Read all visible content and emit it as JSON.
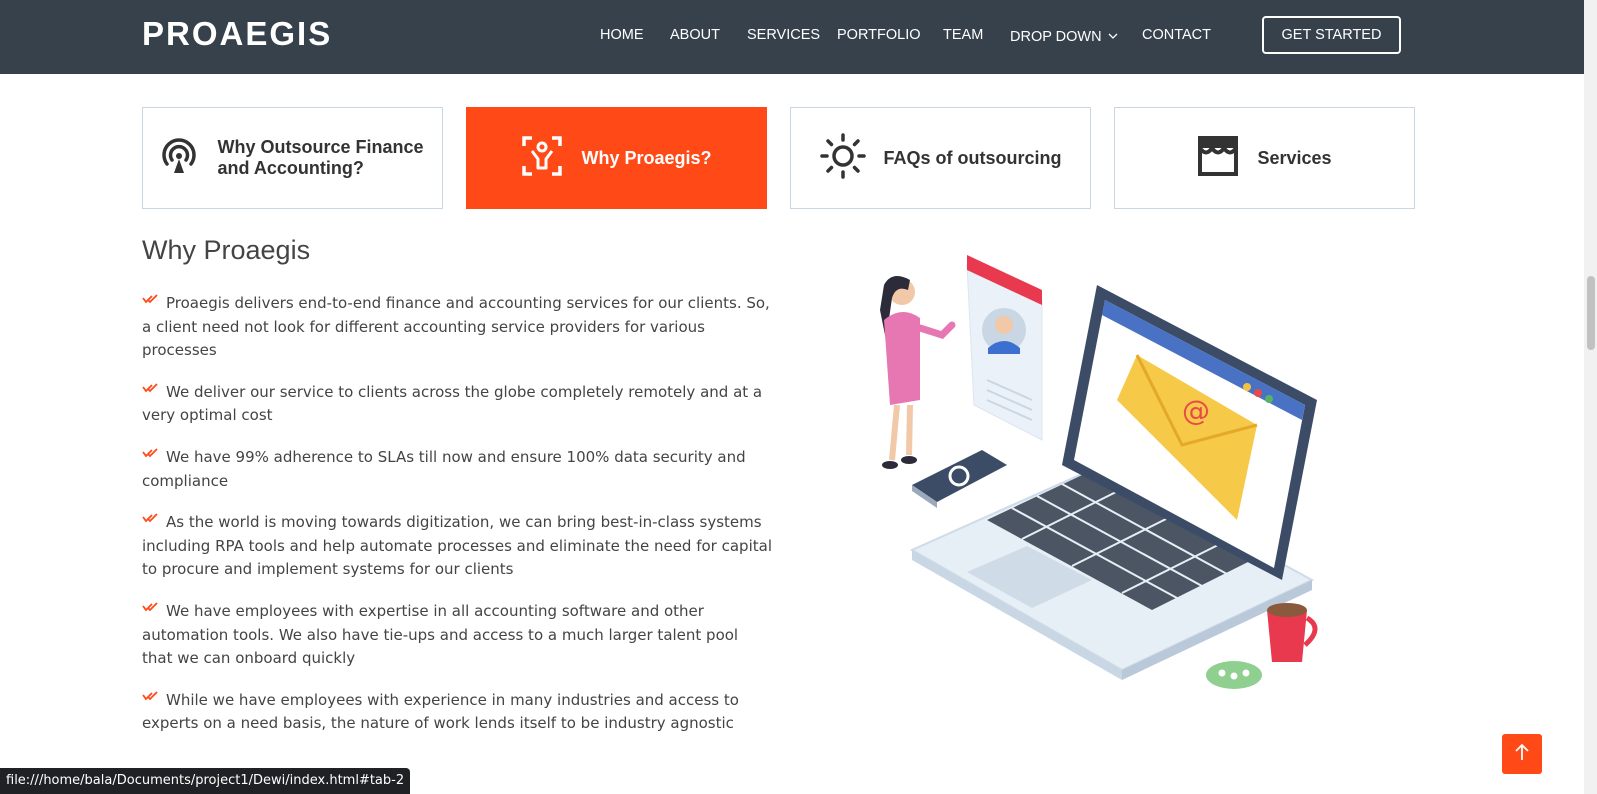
{
  "header": {
    "logo": "PROAEGIS",
    "nav": [
      {
        "label": "HOME"
      },
      {
        "label": "ABOUT"
      },
      {
        "label": "SERVICES"
      },
      {
        "label": "PORTFOLIO"
      },
      {
        "label": "TEAM"
      },
      {
        "label": "DROP DOWN"
      },
      {
        "label": "CONTACT"
      }
    ],
    "cta_label": "GET STARTED"
  },
  "tabs": [
    {
      "label": "Why Outsource Finance and Accounting?",
      "icon": "broadcast-icon",
      "active": false
    },
    {
      "label": "Why Proaegis?",
      "icon": "person-focus-icon",
      "active": true
    },
    {
      "label": "FAQs of outsourcing",
      "icon": "sun-icon",
      "active": false
    },
    {
      "label": "Services",
      "icon": "store-icon",
      "active": false
    }
  ],
  "content": {
    "title": "Why Proaegis",
    "items": [
      "Proaegis delivers end-to-end finance and accounting services for our clients. So, a client need not look for different accounting service providers for various processes",
      "We deliver our service to clients across the globe completely remotely and at a very optimal cost",
      "We have 99% adherence to SLAs till now and ensure 100% data security and compliance",
      "As the world is moving towards digitization, we can bring best-in-class systems including RPA tools and help automate processes and eliminate the need for capital to procure and implement systems for our clients",
      "We have employees with expertise in all accounting software and other automation tools. We also have tie-ups and access to a much larger talent pool that we can onboard quickly",
      "While we have employees with experience in many industries and access to experts on a need basis, the nature of work lends itself to be industry agnostic"
    ]
  },
  "status_url": "file:///home/bala/Documents/project1/Dewi/index.html#tab-2",
  "colors": {
    "accent": "#ff4a17",
    "header_bg": "#37414b"
  }
}
